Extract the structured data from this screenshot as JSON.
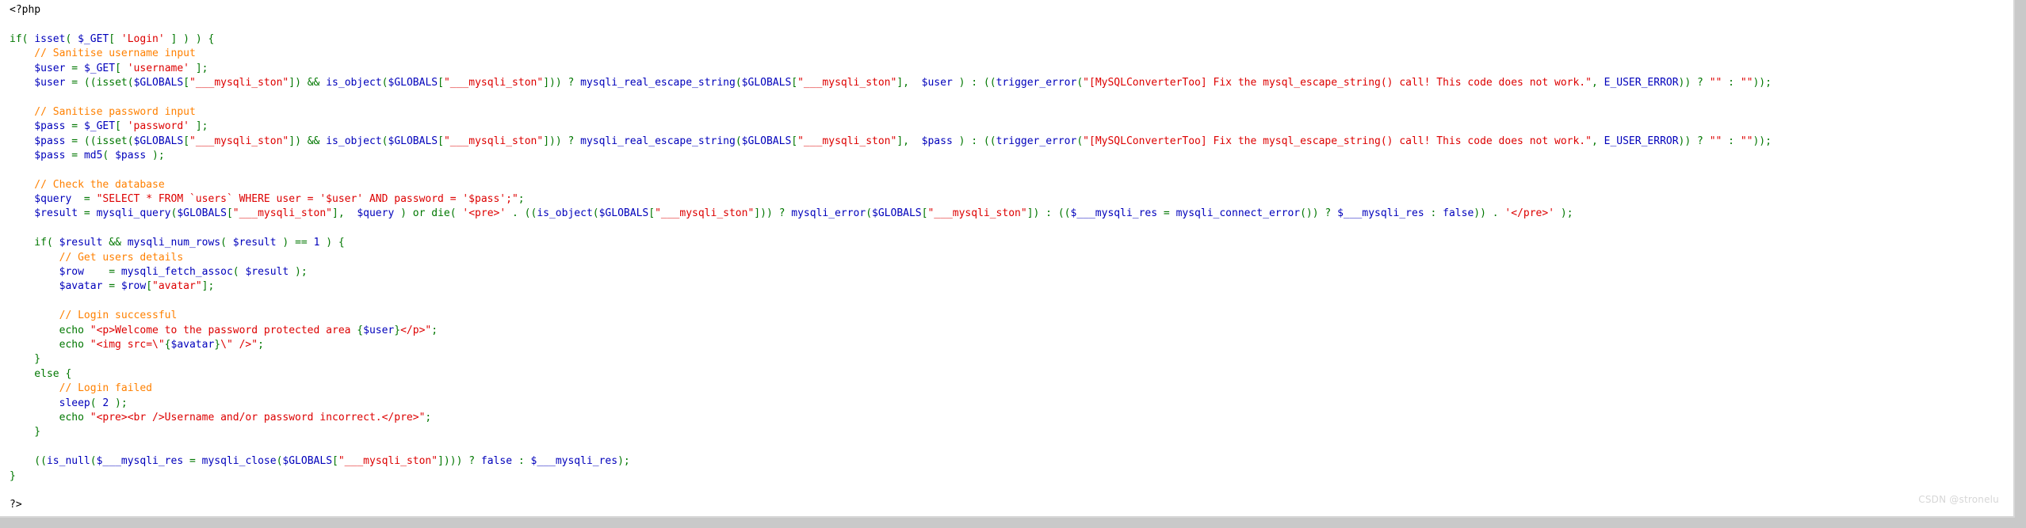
{
  "colors": {
    "background": "#ffffff",
    "keyword": "#007700",
    "function": "#0000bb",
    "string": "#dd0000",
    "comment": "#ff8000",
    "plain": "#000000"
  },
  "code_lines": [
    [
      {
        "t": "plain",
        "v": "<?php"
      }
    ],
    [],
    [
      {
        "t": "kw",
        "v": "if( "
      },
      {
        "t": "fn",
        "v": "isset"
      },
      {
        "t": "kw",
        "v": "( "
      },
      {
        "t": "var",
        "v": "$_GET"
      },
      {
        "t": "kw",
        "v": "[ "
      },
      {
        "t": "str",
        "v": "'Login'"
      },
      {
        "t": "kw",
        "v": " ] ) ) {"
      }
    ],
    [
      {
        "t": "com",
        "v": "    // Sanitise username input"
      }
    ],
    [
      {
        "t": "var",
        "v": "    $user "
      },
      {
        "t": "op",
        "v": "= "
      },
      {
        "t": "var",
        "v": "$_GET"
      },
      {
        "t": "op",
        "v": "[ "
      },
      {
        "t": "str",
        "v": "'username'"
      },
      {
        "t": "op",
        "v": " ];"
      }
    ],
    [
      {
        "t": "var",
        "v": "    $user "
      },
      {
        "t": "op",
        "v": "= ((isset("
      },
      {
        "t": "var",
        "v": "$GLOBALS"
      },
      {
        "t": "op",
        "v": "["
      },
      {
        "t": "str",
        "v": "\"___mysqli_ston\""
      },
      {
        "t": "op",
        "v": "]) && "
      },
      {
        "t": "fn",
        "v": "is_object"
      },
      {
        "t": "op",
        "v": "("
      },
      {
        "t": "var",
        "v": "$GLOBALS"
      },
      {
        "t": "op",
        "v": "["
      },
      {
        "t": "str",
        "v": "\"___mysqli_ston\""
      },
      {
        "t": "op",
        "v": "])) ? "
      },
      {
        "t": "fn",
        "v": "mysqli_real_escape_string"
      },
      {
        "t": "op",
        "v": "("
      },
      {
        "t": "var",
        "v": "$GLOBALS"
      },
      {
        "t": "op",
        "v": "["
      },
      {
        "t": "str",
        "v": "\"___mysqli_ston\""
      },
      {
        "t": "op",
        "v": "],  "
      },
      {
        "t": "var",
        "v": "$user"
      },
      {
        "t": "op",
        "v": " ) : (("
      },
      {
        "t": "fn",
        "v": "trigger_error"
      },
      {
        "t": "op",
        "v": "("
      },
      {
        "t": "str",
        "v": "\"[MySQLConverterToo] Fix the mysql_escape_string() call! This code does not work.\""
      },
      {
        "t": "op",
        "v": ", "
      },
      {
        "t": "fn",
        "v": "E_USER_ERROR"
      },
      {
        "t": "op",
        "v": ")) ? "
      },
      {
        "t": "str",
        "v": "\"\""
      },
      {
        "t": "op",
        "v": " : "
      },
      {
        "t": "str",
        "v": "\"\""
      },
      {
        "t": "op",
        "v": "));"
      }
    ],
    [],
    [
      {
        "t": "com",
        "v": "    // Sanitise password input"
      }
    ],
    [
      {
        "t": "var",
        "v": "    $pass "
      },
      {
        "t": "op",
        "v": "= "
      },
      {
        "t": "var",
        "v": "$_GET"
      },
      {
        "t": "op",
        "v": "[ "
      },
      {
        "t": "str",
        "v": "'password'"
      },
      {
        "t": "op",
        "v": " ];"
      }
    ],
    [
      {
        "t": "var",
        "v": "    $pass "
      },
      {
        "t": "op",
        "v": "= ((isset("
      },
      {
        "t": "var",
        "v": "$GLOBALS"
      },
      {
        "t": "op",
        "v": "["
      },
      {
        "t": "str",
        "v": "\"___mysqli_ston\""
      },
      {
        "t": "op",
        "v": "]) && "
      },
      {
        "t": "fn",
        "v": "is_object"
      },
      {
        "t": "op",
        "v": "("
      },
      {
        "t": "var",
        "v": "$GLOBALS"
      },
      {
        "t": "op",
        "v": "["
      },
      {
        "t": "str",
        "v": "\"___mysqli_ston\""
      },
      {
        "t": "op",
        "v": "])) ? "
      },
      {
        "t": "fn",
        "v": "mysqli_real_escape_string"
      },
      {
        "t": "op",
        "v": "("
      },
      {
        "t": "var",
        "v": "$GLOBALS"
      },
      {
        "t": "op",
        "v": "["
      },
      {
        "t": "str",
        "v": "\"___mysqli_ston\""
      },
      {
        "t": "op",
        "v": "],  "
      },
      {
        "t": "var",
        "v": "$pass"
      },
      {
        "t": "op",
        "v": " ) : (("
      },
      {
        "t": "fn",
        "v": "trigger_error"
      },
      {
        "t": "op",
        "v": "("
      },
      {
        "t": "str",
        "v": "\"[MySQLConverterToo] Fix the mysql_escape_string() call! This code does not work.\""
      },
      {
        "t": "op",
        "v": ", "
      },
      {
        "t": "fn",
        "v": "E_USER_ERROR"
      },
      {
        "t": "op",
        "v": ")) ? "
      },
      {
        "t": "str",
        "v": "\"\""
      },
      {
        "t": "op",
        "v": " : "
      },
      {
        "t": "str",
        "v": "\"\""
      },
      {
        "t": "op",
        "v": "));"
      }
    ],
    [
      {
        "t": "var",
        "v": "    $pass "
      },
      {
        "t": "op",
        "v": "= "
      },
      {
        "t": "fn",
        "v": "md5"
      },
      {
        "t": "op",
        "v": "( "
      },
      {
        "t": "var",
        "v": "$pass"
      },
      {
        "t": "op",
        "v": " );"
      }
    ],
    [],
    [
      {
        "t": "com",
        "v": "    // Check the database"
      }
    ],
    [
      {
        "t": "var",
        "v": "    $query  "
      },
      {
        "t": "op",
        "v": "= "
      },
      {
        "t": "str",
        "v": "\"SELECT * FROM `users` WHERE user = '$user' AND password = '$pass';\""
      },
      {
        "t": "op",
        "v": ";"
      }
    ],
    [
      {
        "t": "var",
        "v": "    $result "
      },
      {
        "t": "op",
        "v": "= "
      },
      {
        "t": "fn",
        "v": "mysqli_query"
      },
      {
        "t": "op",
        "v": "("
      },
      {
        "t": "var",
        "v": "$GLOBALS"
      },
      {
        "t": "op",
        "v": "["
      },
      {
        "t": "str",
        "v": "\"___mysqli_ston\""
      },
      {
        "t": "op",
        "v": "],  "
      },
      {
        "t": "var",
        "v": "$query"
      },
      {
        "t": "op",
        "v": " ) or die( "
      },
      {
        "t": "str",
        "v": "'<pre>'"
      },
      {
        "t": "op",
        "v": " . (("
      },
      {
        "t": "fn",
        "v": "is_object"
      },
      {
        "t": "op",
        "v": "("
      },
      {
        "t": "var",
        "v": "$GLOBALS"
      },
      {
        "t": "op",
        "v": "["
      },
      {
        "t": "str",
        "v": "\"___mysqli_ston\""
      },
      {
        "t": "op",
        "v": "])) ? "
      },
      {
        "t": "fn",
        "v": "mysqli_error"
      },
      {
        "t": "op",
        "v": "("
      },
      {
        "t": "var",
        "v": "$GLOBALS"
      },
      {
        "t": "op",
        "v": "["
      },
      {
        "t": "str",
        "v": "\"___mysqli_ston\""
      },
      {
        "t": "op",
        "v": "]) : (("
      },
      {
        "t": "var",
        "v": "$___mysqli_res"
      },
      {
        "t": "op",
        "v": " = "
      },
      {
        "t": "fn",
        "v": "mysqli_connect_error"
      },
      {
        "t": "op",
        "v": "()) ? "
      },
      {
        "t": "var",
        "v": "$___mysqli_res"
      },
      {
        "t": "op",
        "v": " : "
      },
      {
        "t": "fn",
        "v": "false"
      },
      {
        "t": "op",
        "v": ")) . "
      },
      {
        "t": "str",
        "v": "'</pre>'"
      },
      {
        "t": "op",
        "v": " );"
      }
    ],
    [],
    [
      {
        "t": "kw",
        "v": "    if( "
      },
      {
        "t": "var",
        "v": "$result"
      },
      {
        "t": "op",
        "v": " && "
      },
      {
        "t": "fn",
        "v": "mysqli_num_rows"
      },
      {
        "t": "op",
        "v": "( "
      },
      {
        "t": "var",
        "v": "$result"
      },
      {
        "t": "op",
        "v": " ) == "
      },
      {
        "t": "num",
        "v": "1"
      },
      {
        "t": "op",
        "v": " ) {"
      }
    ],
    [
      {
        "t": "com",
        "v": "        // Get users details"
      }
    ],
    [
      {
        "t": "var",
        "v": "        $row    "
      },
      {
        "t": "op",
        "v": "= "
      },
      {
        "t": "fn",
        "v": "mysqli_fetch_assoc"
      },
      {
        "t": "op",
        "v": "( "
      },
      {
        "t": "var",
        "v": "$result"
      },
      {
        "t": "op",
        "v": " );"
      }
    ],
    [
      {
        "t": "var",
        "v": "        $avatar "
      },
      {
        "t": "op",
        "v": "= "
      },
      {
        "t": "var",
        "v": "$row"
      },
      {
        "t": "op",
        "v": "["
      },
      {
        "t": "str",
        "v": "\"avatar\""
      },
      {
        "t": "op",
        "v": "];"
      }
    ],
    [],
    [
      {
        "t": "com",
        "v": "        // Login successful"
      }
    ],
    [
      {
        "t": "kw",
        "v": "        echo "
      },
      {
        "t": "str",
        "v": "\"<p>Welcome to the password protected area "
      },
      {
        "t": "op",
        "v": "{"
      },
      {
        "t": "var",
        "v": "$user"
      },
      {
        "t": "op",
        "v": "}"
      },
      {
        "t": "str",
        "v": "</p>\""
      },
      {
        "t": "op",
        "v": ";"
      }
    ],
    [
      {
        "t": "kw",
        "v": "        echo "
      },
      {
        "t": "str",
        "v": "\"<img src=\\\""
      },
      {
        "t": "op",
        "v": "{"
      },
      {
        "t": "var",
        "v": "$avatar"
      },
      {
        "t": "op",
        "v": "}"
      },
      {
        "t": "str",
        "v": "\\\" />\""
      },
      {
        "t": "op",
        "v": ";"
      }
    ],
    [
      {
        "t": "kw",
        "v": "    }"
      }
    ],
    [
      {
        "t": "kw",
        "v": "    else {"
      }
    ],
    [
      {
        "t": "com",
        "v": "        // Login failed"
      }
    ],
    [
      {
        "t": "fn",
        "v": "        sleep"
      },
      {
        "t": "op",
        "v": "( "
      },
      {
        "t": "num",
        "v": "2"
      },
      {
        "t": "op",
        "v": " );"
      }
    ],
    [
      {
        "t": "kw",
        "v": "        echo "
      },
      {
        "t": "str",
        "v": "\"<pre><br />Username and/or password incorrect.</pre>\""
      },
      {
        "t": "op",
        "v": ";"
      }
    ],
    [
      {
        "t": "kw",
        "v": "    }"
      }
    ],
    [],
    [
      {
        "t": "op",
        "v": "    (("
      },
      {
        "t": "fn",
        "v": "is_null"
      },
      {
        "t": "op",
        "v": "("
      },
      {
        "t": "var",
        "v": "$___mysqli_res"
      },
      {
        "t": "op",
        "v": " = "
      },
      {
        "t": "fn",
        "v": "mysqli_close"
      },
      {
        "t": "op",
        "v": "("
      },
      {
        "t": "var",
        "v": "$GLOBALS"
      },
      {
        "t": "op",
        "v": "["
      },
      {
        "t": "str",
        "v": "\"___mysqli_ston\""
      },
      {
        "t": "op",
        "v": "]))) ? "
      },
      {
        "t": "fn",
        "v": "false"
      },
      {
        "t": "op",
        "v": " : "
      },
      {
        "t": "var",
        "v": "$___mysqli_res"
      },
      {
        "t": "op",
        "v": ");"
      }
    ],
    [
      {
        "t": "kw",
        "v": "}"
      }
    ],
    [],
    [
      {
        "t": "plain",
        "v": "?>"
      }
    ]
  ],
  "watermark": "CSDN @stronelu"
}
